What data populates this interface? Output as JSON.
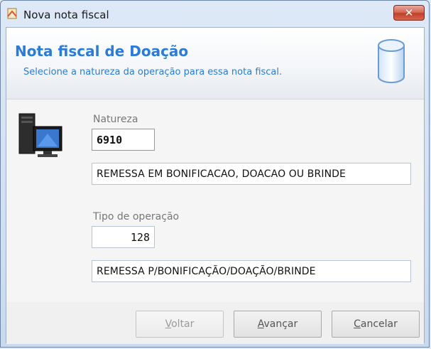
{
  "window": {
    "title": "Nova nota fiscal",
    "close_label": "✕"
  },
  "header": {
    "title": "Nota fiscal de Doação",
    "subtitle": "Selecione a natureza da operação para essa nota fiscal."
  },
  "form": {
    "natureza": {
      "label": "Natureza",
      "code": "6910",
      "description": "REMESSA EM BONIFICACAO, DOACAO OU BRINDE"
    },
    "tipo_operacao": {
      "label": "Tipo de operação",
      "code": "128",
      "description": "REMESSA P/BONIFICAÇÃO/DOAÇÃO/BRINDE"
    }
  },
  "buttons": {
    "voltar": {
      "first": "V",
      "rest": "oltar"
    },
    "avancar": {
      "first": "A",
      "rest": "vançar"
    },
    "cancelar": {
      "first": "C",
      "rest": "ancelar"
    }
  },
  "icons": {
    "app": "document-icon",
    "header": "database-icon",
    "body": "computer-icon"
  }
}
